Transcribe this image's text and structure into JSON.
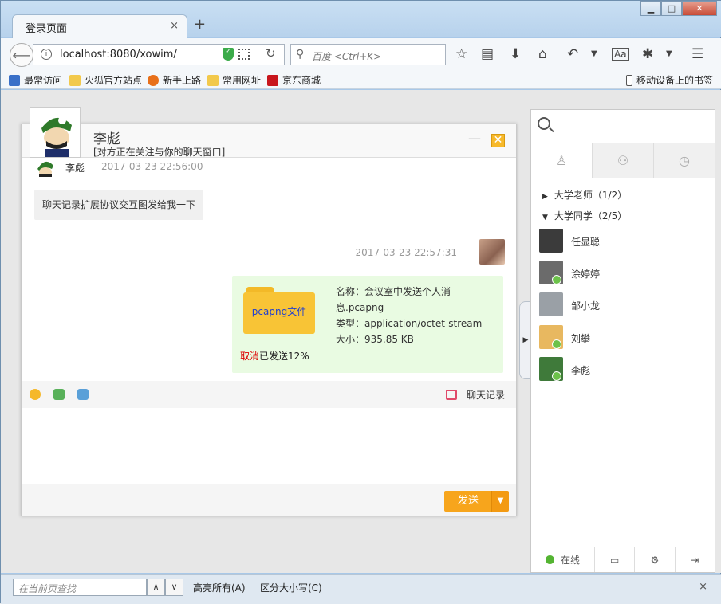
{
  "browser": {
    "tab_title": "登录页面",
    "tab_close": "×",
    "new_tab": "+",
    "url": "localhost:8080/xowim/",
    "search_placeholder": "百度 <Ctrl+K>",
    "window_buttons": [
      "▭",
      "□",
      "✕"
    ]
  },
  "bookmarks": [
    {
      "label": "最常访问",
      "color": "#3a70c8"
    },
    {
      "label": "火狐官方站点",
      "color": "#f2c94c"
    },
    {
      "label": "新手上路",
      "color": "#e8701a"
    },
    {
      "label": "常用网址",
      "color": "#f2c94c"
    },
    {
      "label": "京东商城",
      "color": "#c8161d"
    }
  ],
  "mobile_bookmarks": "移动设备上的书签",
  "chat": {
    "name": "李彪",
    "sign": "[对方正在关注与你的聊天窗口]",
    "min": "—",
    "close": "✕",
    "msg1": {
      "name": "李彪",
      "time": "2017-03-23 22:56:00",
      "text": "聊天记录扩展协议交互图发给我一下"
    },
    "msg2": {
      "time": "2017-03-23 22:57:31",
      "folder_label": "pcapng文件",
      "file_name": "名称：会议室中发送个人消息.pcapng",
      "file_type": "类型：application/octet-stream",
      "file_size": "大小：935.85 KB",
      "cancel": "取消",
      "status": "已发送12%"
    },
    "history": "聊天记录",
    "send": "发送",
    "send_dd": "▼"
  },
  "sidebar": {
    "groups": [
      {
        "label": "大学老师（1/2）",
        "arrow": "▶"
      },
      {
        "label": "大学同学（2/5）",
        "arrow": "▼"
      }
    ],
    "friends": [
      {
        "name": "任显聪",
        "color": "#3b3b3b",
        "online": false
      },
      {
        "name": "涂婷婷",
        "color": "#6b6b6b",
        "online": true
      },
      {
        "name": "邹小龙",
        "color": "#9aa0a6",
        "online": false
      },
      {
        "name": "刘攀",
        "color": "#e8b860",
        "online": true
      },
      {
        "name": "李彪",
        "color": "#3f7a3a",
        "online": true
      }
    ],
    "status": "在线",
    "toggle_arrow": "▶"
  },
  "findbar": {
    "placeholder": "在当前页查找",
    "highlight": "高亮所有(A)",
    "matchcase": "区分大小写(C)",
    "close": "×"
  }
}
